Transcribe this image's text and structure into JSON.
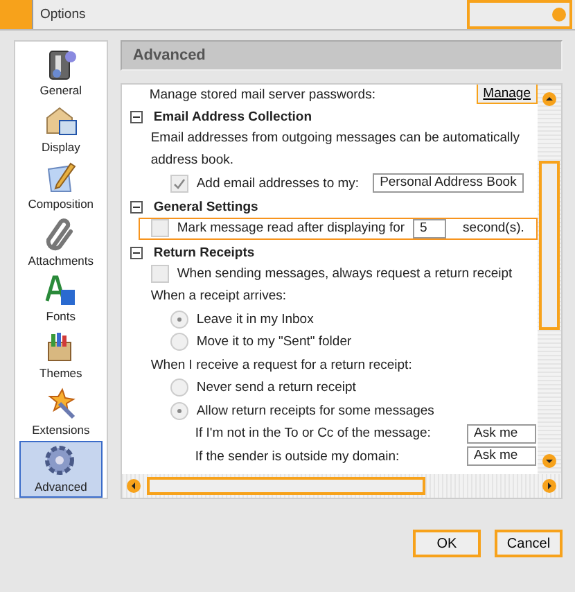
{
  "window": {
    "title": "Options"
  },
  "sidebar": {
    "items": [
      {
        "label": "General",
        "selected": false
      },
      {
        "label": "Display",
        "selected": false
      },
      {
        "label": "Composition",
        "selected": false
      },
      {
        "label": "Attachments",
        "selected": false
      },
      {
        "label": "Fonts",
        "selected": false
      },
      {
        "label": "Themes",
        "selected": false
      },
      {
        "label": "Extensions",
        "selected": false
      },
      {
        "label": "Advanced",
        "selected": true
      }
    ]
  },
  "panel": {
    "title": "Advanced",
    "top_row": {
      "text": "Manage stored mail server passwords:",
      "button": "Manage"
    },
    "sections": [
      {
        "label": "Email Address Collection",
        "expanded": true,
        "items": [
          {
            "kind": "text",
            "text": "Email addresses from outgoing messages can be automatically"
          },
          {
            "kind": "text",
            "text": "address book."
          },
          {
            "kind": "checkbox",
            "label": "Add email addresses to my:",
            "checked": true,
            "select": "Personal Address Book",
            "focused": false
          }
        ]
      },
      {
        "label": "General Settings",
        "expanded": true,
        "items": [
          {
            "kind": "checkbox",
            "label": "Mark message read after displaying for",
            "checked": false,
            "input": "5",
            "suffix": "second(s).",
            "focused": true
          }
        ]
      },
      {
        "label": "Return Receipts",
        "expanded": true,
        "items": [
          {
            "kind": "checkbox",
            "label": "When sending messages, always request a return receipt",
            "checked": false,
            "focused": false
          },
          {
            "kind": "text",
            "text": "When a receipt arrives:"
          },
          {
            "kind": "radio",
            "label": "Leave it in my Inbox",
            "selected": true
          },
          {
            "kind": "radio",
            "label": "Move it to my \"Sent\" folder",
            "selected": false
          },
          {
            "kind": "text",
            "text": "When I receive a request for a return receipt:"
          },
          {
            "kind": "radio",
            "label": "Never send a return receipt",
            "selected": false
          },
          {
            "kind": "radio",
            "label": "Allow return receipts for some messages",
            "selected": true
          },
          {
            "kind": "select",
            "label": "If I'm not in the To or Cc of the message:",
            "value": "Ask me"
          },
          {
            "kind": "select",
            "label": "If the sender is outside my domain:",
            "value": "Ask me"
          }
        ]
      }
    ]
  },
  "buttons": [
    {
      "label": "OK"
    },
    {
      "label": "Cancel"
    }
  ]
}
